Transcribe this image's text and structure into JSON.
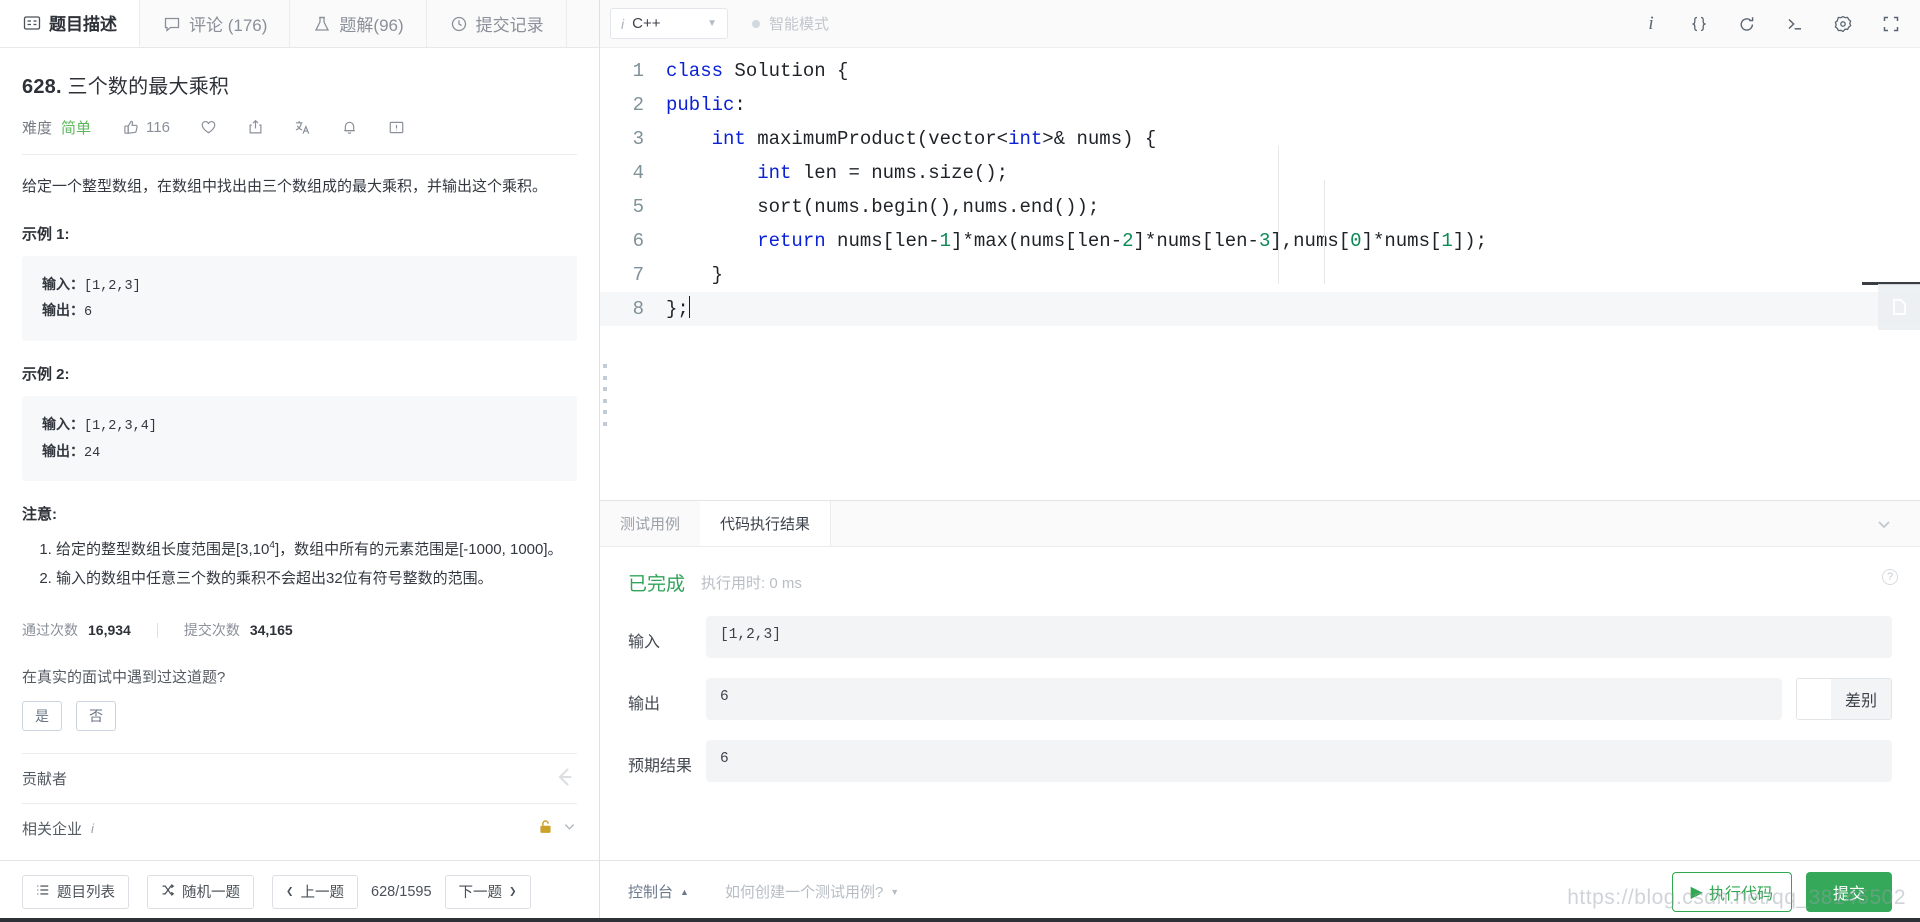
{
  "left": {
    "tabs": [
      {
        "label": "题目描述",
        "icon": "description-icon",
        "active": true
      },
      {
        "label": "评论 (176)",
        "icon": "comment-icon",
        "active": false
      },
      {
        "label": "题解(96)",
        "icon": "flask-icon",
        "active": false
      },
      {
        "label": "提交记录",
        "icon": "clock-icon",
        "active": false
      }
    ],
    "problem": {
      "number": "628.",
      "title": "三个数的最大乘积",
      "difficulty_label": "难度",
      "difficulty": "简单",
      "likes": "116",
      "description": "给定一个整型数组，在数组中找出由三个数组成的最大乘积，并输出这个乘积。",
      "example1_heading": "示例 1:",
      "example1": {
        "in_label": "输入：",
        "in_value": "[1,2,3]",
        "out_label": "输出：",
        "out_value": "6"
      },
      "example2_heading": "示例 2:",
      "example2": {
        "in_label": "输入：",
        "in_value": "[1,2,3,4]",
        "out_label": "输出：",
        "out_value": "24"
      },
      "notes_heading": "注意:",
      "notes": [
        "给定的整型数组长度范围是[3,10⁴]，数组中所有的元素范围是[-1000, 1000]。",
        "输入的数组中任意三个数的乘积不会超出32位有符号整数的范围。"
      ],
      "notes_plain": [
        {
          "pre": "给定的整型数组长度范围是[3,10",
          "sup": "4",
          "post": "]，数组中所有的元素范围是[-1000, 1000]。"
        },
        {
          "pre": "输入的数组中任意三个数的乘积不会超出32位有符号整数的范围。",
          "sup": "",
          "post": ""
        }
      ]
    },
    "stats": {
      "accepted_label": "通过次数",
      "accepted_value": "16,934",
      "submissions_label": "提交次数",
      "submissions_value": "34,165"
    },
    "interview": {
      "question": "在真实的面试中遇到过这道题?",
      "yes": "是",
      "no": "否"
    },
    "contributor_label": "贡献者",
    "company_label": "相关企业",
    "bottom": {
      "list_label": "题目列表",
      "random_label": "随机一题",
      "prev_label": "上一题",
      "page_indicator": "628/1595",
      "next_label": "下一题"
    }
  },
  "editor": {
    "language": "C++",
    "smart_mode": "智能模式",
    "tools": [
      {
        "name": "info-icon",
        "glyph": "i"
      },
      {
        "name": "braces-icon",
        "glyph": "{}"
      },
      {
        "name": "reset-icon",
        "glyph": "↺"
      },
      {
        "name": "terminal-icon",
        "glyph": ">_"
      },
      {
        "name": "settings-gear-icon",
        "glyph": "⚙"
      },
      {
        "name": "fullscreen-icon",
        "glyph": "⛶"
      }
    ],
    "lines": [
      {
        "n": "1",
        "tokens": [
          {
            "t": "class ",
            "c": "kw"
          },
          {
            "t": "Solution {",
            "c": ""
          }
        ]
      },
      {
        "n": "2",
        "tokens": [
          {
            "t": "public",
            "c": "kw"
          },
          {
            "t": ":",
            "c": ""
          }
        ]
      },
      {
        "n": "3",
        "tokens": [
          {
            "t": "    ",
            "c": ""
          },
          {
            "t": "int",
            "c": "ty"
          },
          {
            "t": " maximumProduct(vector<",
            "c": ""
          },
          {
            "t": "int",
            "c": "ty"
          },
          {
            "t": ">& nums) {",
            "c": ""
          }
        ]
      },
      {
        "n": "4",
        "tokens": [
          {
            "t": "        ",
            "c": ""
          },
          {
            "t": "int",
            "c": "ty"
          },
          {
            "t": " len = nums.size();",
            "c": ""
          }
        ]
      },
      {
        "n": "5",
        "tokens": [
          {
            "t": "        sort(nums.begin(),nums.end());",
            "c": ""
          }
        ]
      },
      {
        "n": "6",
        "tokens": [
          {
            "t": "        ",
            "c": ""
          },
          {
            "t": "return",
            "c": "kw"
          },
          {
            "t": " nums[len-",
            "c": ""
          },
          {
            "t": "1",
            "c": "nm"
          },
          {
            "t": "]*max(nums[len-",
            "c": ""
          },
          {
            "t": "2",
            "c": "nm"
          },
          {
            "t": "]*nums[len-",
            "c": ""
          },
          {
            "t": "3",
            "c": "nm"
          },
          {
            "t": "],nums[",
            "c": ""
          },
          {
            "t": "0",
            "c": "nm"
          },
          {
            "t": "]*nums[",
            "c": ""
          },
          {
            "t": "1",
            "c": "nm"
          },
          {
            "t": "]);",
            "c": ""
          }
        ]
      },
      {
        "n": "7",
        "tokens": [
          {
            "t": "    }",
            "c": ""
          }
        ]
      },
      {
        "n": "8",
        "tokens": [
          {
            "t": "};",
            "c": ""
          }
        ]
      }
    ]
  },
  "results": {
    "tabs": [
      {
        "label": "测试用例",
        "active": false
      },
      {
        "label": "代码执行结果",
        "active": true
      }
    ],
    "status": "已完成",
    "runtime": "执行用时: 0 ms",
    "input_label": "输入",
    "input_value": "[1,2,3]",
    "output_label": "输出",
    "output_value": "6",
    "expected_label": "预期结果",
    "expected_value": "6",
    "diff_label": "差别"
  },
  "bottom_bar": {
    "console": "控制台",
    "how_to": "如何创建一个测试用例?",
    "run": "执行代码",
    "submit": "提交"
  },
  "watermark": "https://blog.csdn.net/qq_38145502"
}
